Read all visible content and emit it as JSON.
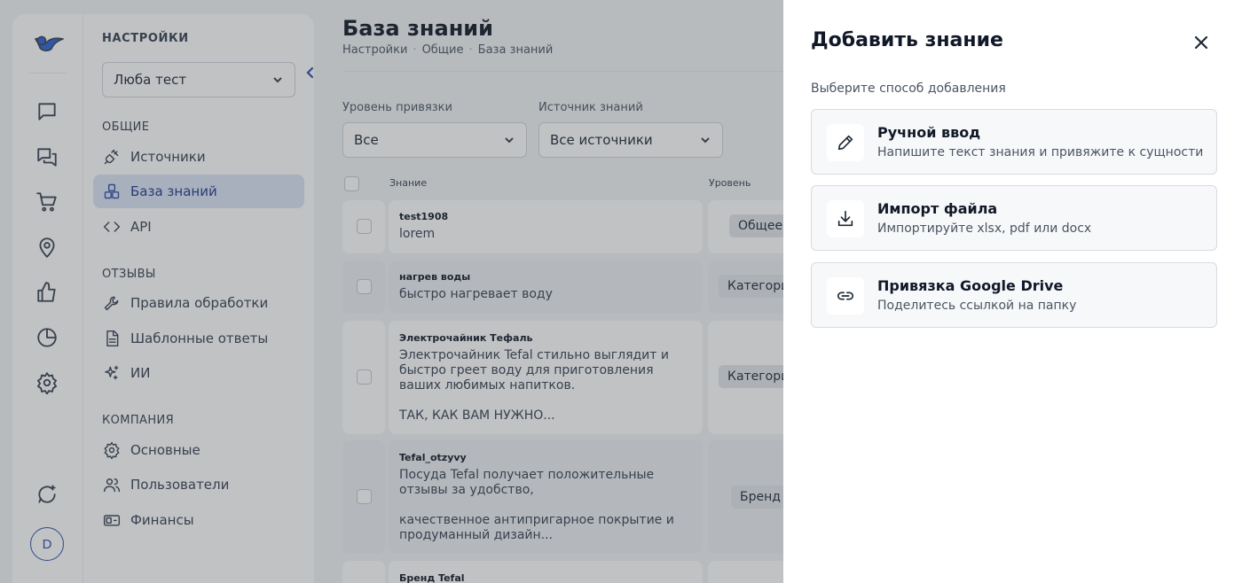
{
  "sidebar": {
    "header": "НАСТРОЙКИ",
    "account_select": "Люба тест",
    "groups": {
      "general": "ОБЩИЕ",
      "reviews": "ОТЗЫВЫ",
      "company": "КОМПАНИЯ"
    },
    "items": {
      "sources": "Источники",
      "knowledge_base": "База знаний",
      "api": "API",
      "rules": "Правила обработки",
      "templates": "Шаблонные ответы",
      "ai": "ИИ",
      "basic": "Основные",
      "users": "Пользователи",
      "finance": "Финансы"
    },
    "active_item": "knowledge_base"
  },
  "rail": {
    "avatar_letter": "D"
  },
  "main": {
    "title": "База знаний",
    "breadcrumbs": [
      "Настройки",
      "Общие",
      "База знаний"
    ],
    "filters": {
      "level_label": "Уровень привязки",
      "level_value": "Все",
      "source_label": "Источник знаний",
      "source_value": "Все источники"
    },
    "table": {
      "col_knowledge": "Знание",
      "col_level": "Уровень",
      "rows": [
        {
          "title": "test1908",
          "text": "lorem",
          "level": "Общее"
        },
        {
          "title": "нагрев воды",
          "text": "быстро нагревает воду",
          "level": "Категория"
        },
        {
          "title": "Электрочайник Тефаль",
          "text": "Электрочайник Tefal стильно выглядит и быстро греет воду для приготовления ваших любимых напитков.\n\nТАК, КАК ВАМ НУЖНО...",
          "level": "Категория"
        },
        {
          "title": "Tefal_otzyvy",
          "text": "Посуда Tefal получает положительные отзывы за удобство,\n\nкачественное антипригарное покрытие и продуманный дизайн...",
          "level": "Бренд"
        },
        {
          "title": "Бренд Tefal",
          "text": "",
          "level": ""
        }
      ]
    }
  },
  "drawer": {
    "title": "Добавить знание",
    "subtitle": "Выберите способ добавления",
    "options": [
      {
        "title": "Ручной ввод",
        "desc": "Напишите текст знания и привяжите к сущности",
        "icon": "pencil-icon"
      },
      {
        "title": "Импорт файла",
        "desc": "Импортируйте xlsx, pdf или docx",
        "icon": "download-icon"
      },
      {
        "title": "Привязка Google Drive",
        "desc": "Поделитесь ссылкой на папку",
        "icon": "link-icon"
      }
    ]
  },
  "colors": {
    "accent": "#2f4ea8",
    "active_bg": "#dce5f6",
    "logo_blue": "#2c64d6"
  }
}
